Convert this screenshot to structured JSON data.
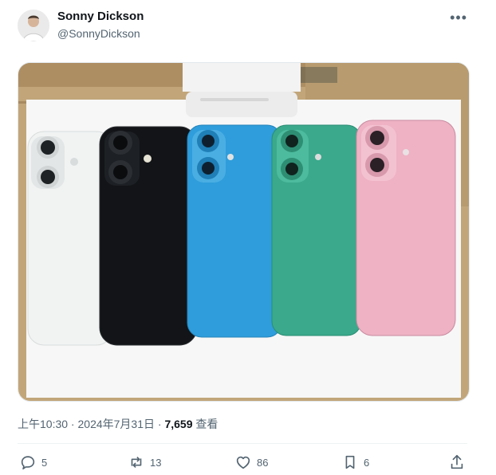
{
  "post": {
    "author_name": "Sonny Dickson",
    "author_handle": "@SonnyDickson",
    "more_icon": "more-horizontal-icon",
    "meta": {
      "time": "上午10:30",
      "separator1": " · ",
      "date": "2024年7月31日",
      "separator2": " · ",
      "views_count": "7,659",
      "views_label": " 查看"
    },
    "actions": {
      "reply_count": "5",
      "repost_count": "13",
      "like_count": "86",
      "bookmark_count": "6"
    }
  },
  "photo": {
    "subject": "five phone dummies on white card",
    "phone_colors": [
      "#f1f3f3",
      "#121417",
      "#2f9ddb",
      "#3aa98c",
      "#eeb2c4"
    ],
    "background_colors": [
      "#c2a67a",
      "#f7f7f7"
    ]
  },
  "colors": {
    "text_primary": "#0f1419",
    "text_secondary": "#536471",
    "divider": "#eff3f4"
  }
}
